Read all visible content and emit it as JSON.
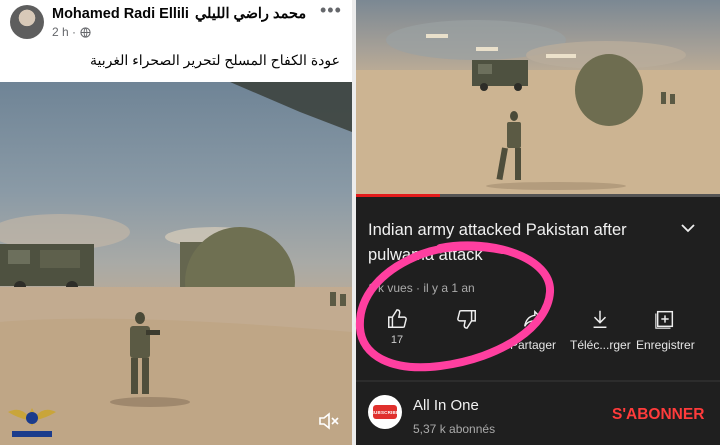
{
  "facebook": {
    "author_name": "Mohamed Radi Ellili",
    "author_name_ar": "محمد راضي الليلي",
    "time": "2 h ·",
    "caption": "عودة الكفاح المسلح لتحرير الصحراء الغربية",
    "more_icon": "more-dots-icon",
    "mute_icon": "speaker-muted-icon"
  },
  "youtube": {
    "title": "Indian army attacked Pakistan after pulwama attack",
    "meta": "1 k vues · il y a 1 an",
    "progress": 0.23,
    "like_count": "17",
    "actions": {
      "share": "Partager",
      "download": "Téléc...rger",
      "save": "Enregistrer"
    },
    "channel": {
      "name": "All In One",
      "subscribers": "5,37 k abonnés",
      "logo_text": "SUBSCRIBE"
    },
    "subscribe_label": "S'ABONNER",
    "accent_color": "#e21b1b"
  },
  "annotation": {
    "color": "#ff3fa0"
  }
}
